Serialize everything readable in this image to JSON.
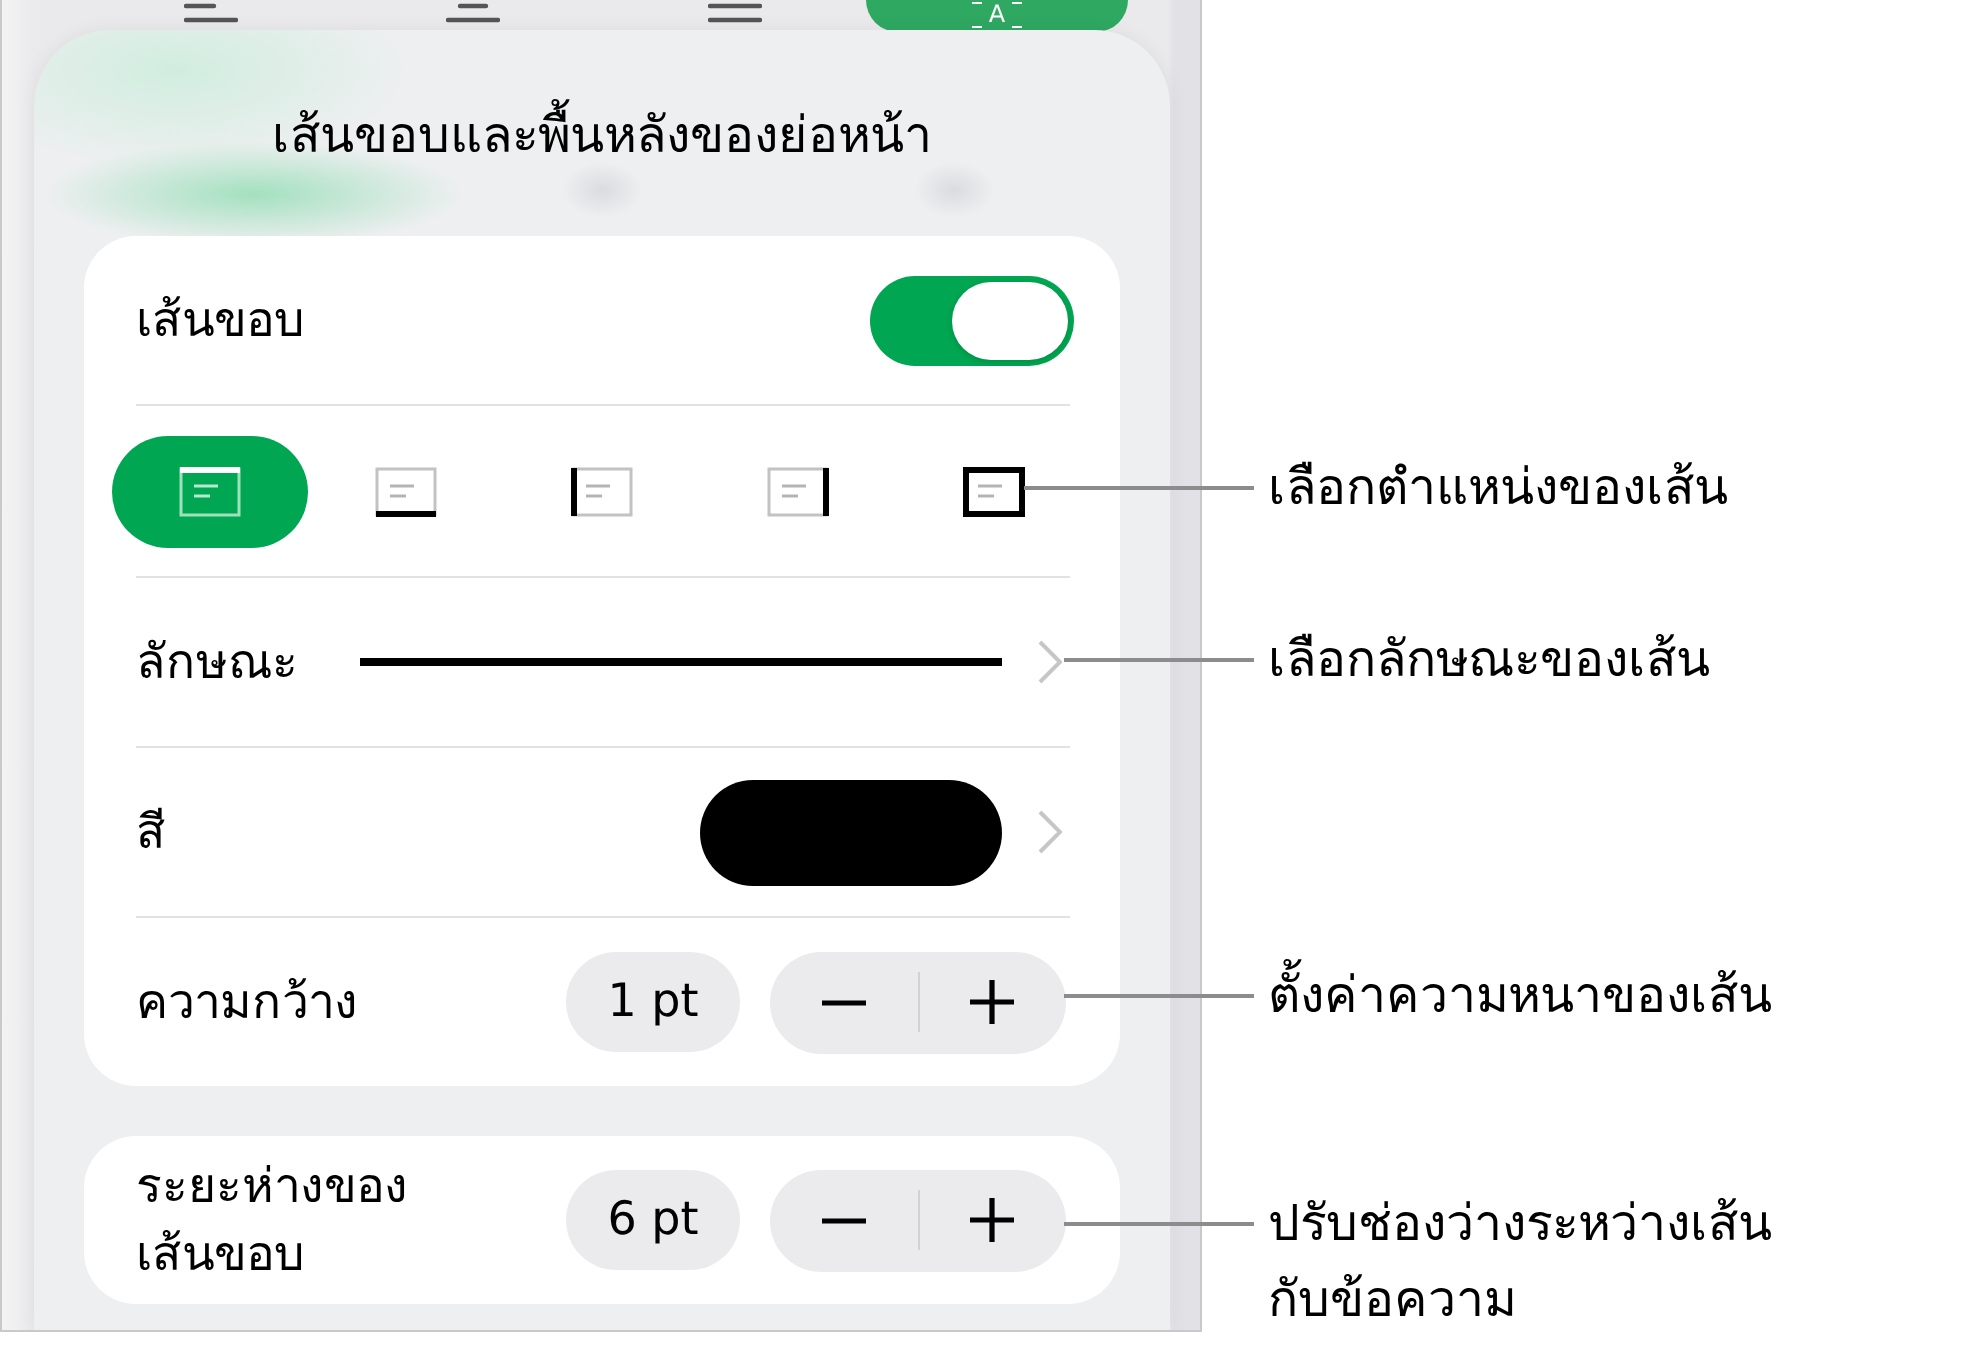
{
  "toolbar": {
    "tabs": [
      {
        "kind": "align-left",
        "selected": false
      },
      {
        "kind": "align-center",
        "selected": false
      },
      {
        "kind": "align-justify",
        "selected": false
      },
      {
        "kind": "format",
        "glyph": "A",
        "selected": true
      }
    ]
  },
  "popover": {
    "title": "เส้นขอบและพื้นหลังของย่อหน้า"
  },
  "border": {
    "label": "เส้นขอบ",
    "on": true,
    "positions": [
      {
        "kind": "top",
        "selected": true
      },
      {
        "kind": "bottom",
        "selected": false
      },
      {
        "kind": "left",
        "selected": false
      },
      {
        "kind": "right",
        "selected": false
      },
      {
        "kind": "box",
        "selected": false
      }
    ],
    "style": {
      "label": "ลักษณะ"
    },
    "color": {
      "label": "สี",
      "color": "#000000"
    },
    "width": {
      "label": "ความกว้าง",
      "value": "1 pt"
    }
  },
  "spacing": {
    "label": "ระยะห่างของเส้นขอบ",
    "value": "6 pt"
  },
  "callouts": [
    {
      "text": "เลือกตำแหน่งของเส้น"
    },
    {
      "text": "เลือกลักษณะของเส้น"
    },
    {
      "text": "ตั้งค่าความหนาของเส้น"
    },
    {
      "text": "ปรับช่องว่างระหว่างเส้นกับข้อความ"
    }
  ]
}
